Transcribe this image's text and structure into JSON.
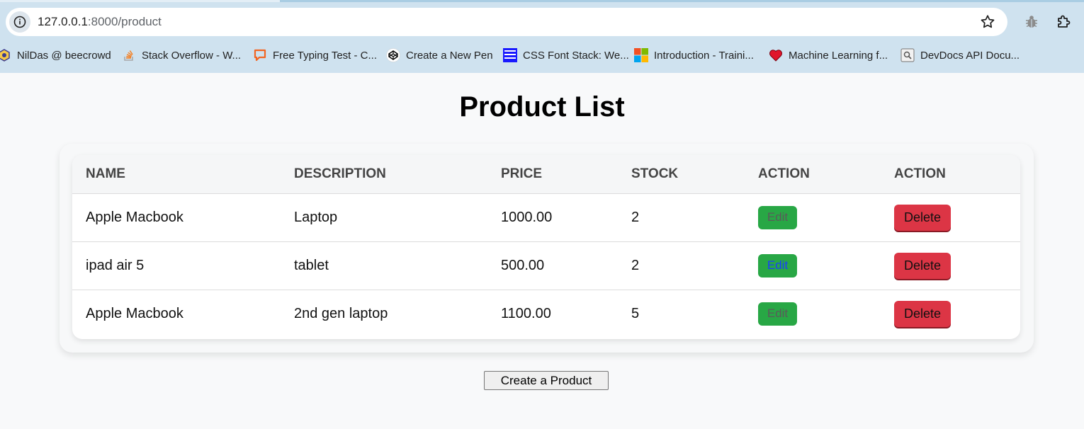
{
  "browser": {
    "url_host": "127.0.0.1",
    "url_rest": ":8000/product",
    "bookmarks": [
      {
        "label": "NilDas @ beecrowd",
        "icon": "beecrowd-icon"
      },
      {
        "label": "Stack Overflow - W...",
        "icon": "stackoverflow-icon"
      },
      {
        "label": "Free Typing Test - C...",
        "icon": "chat-bubble-icon"
      },
      {
        "label": "Create a New Pen",
        "icon": "codepen-icon"
      },
      {
        "label": "CSS Font Stack: We...",
        "icon": "cssfontstack-icon"
      },
      {
        "label": "Introduction - Traini...",
        "icon": "microsoft-icon"
      },
      {
        "label": "Machine Learning f...",
        "icon": "heart-icon"
      },
      {
        "label": "DevDocs API Docu...",
        "icon": "devdocs-icon"
      }
    ]
  },
  "page": {
    "title": "Product List",
    "create_label": "Create a Product"
  },
  "table": {
    "headers": [
      "NAME",
      "DESCRIPTION",
      "PRICE",
      "STOCK",
      "ACTION",
      "ACTION"
    ],
    "rows": [
      {
        "name": "Apple Macbook",
        "description": "Laptop",
        "price": "1000.00",
        "stock": "2",
        "edit": "Edit",
        "delete": "Delete"
      },
      {
        "name": "ipad air 5",
        "description": "tablet",
        "price": "500.00",
        "stock": "2",
        "edit": "Edit",
        "delete": "Delete"
      },
      {
        "name": "Apple Macbook",
        "description": "2nd gen laptop",
        "price": "1100.00",
        "stock": "5",
        "edit": "Edit",
        "delete": "Delete"
      }
    ]
  },
  "colors": {
    "edit_button": "#28a745",
    "delete_button": "#dc3545",
    "page_background": "#f8f9fa",
    "chrome_background": "#cfe2ef"
  }
}
